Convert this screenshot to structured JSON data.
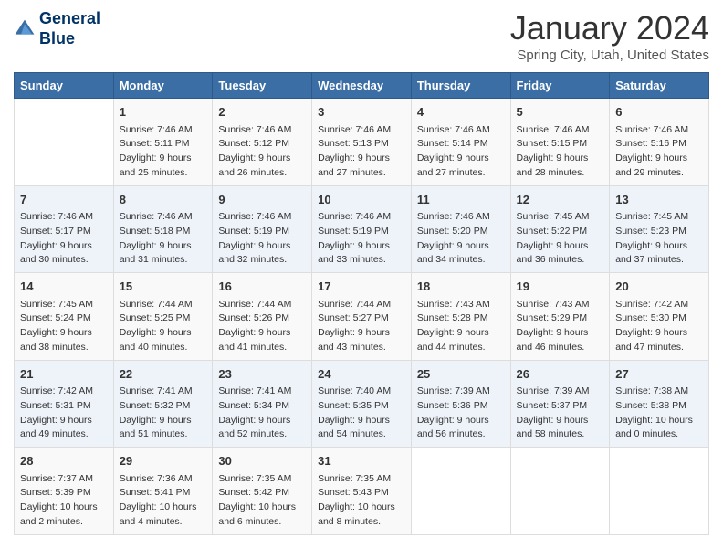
{
  "header": {
    "logo_line1": "General",
    "logo_line2": "Blue",
    "title": "January 2024",
    "subtitle": "Spring City, Utah, United States"
  },
  "days_of_week": [
    "Sunday",
    "Monday",
    "Tuesday",
    "Wednesday",
    "Thursday",
    "Friday",
    "Saturday"
  ],
  "weeks": [
    [
      {
        "num": "",
        "info": ""
      },
      {
        "num": "1",
        "info": "Sunrise: 7:46 AM\nSunset: 5:11 PM\nDaylight: 9 hours\nand 25 minutes."
      },
      {
        "num": "2",
        "info": "Sunrise: 7:46 AM\nSunset: 5:12 PM\nDaylight: 9 hours\nand 26 minutes."
      },
      {
        "num": "3",
        "info": "Sunrise: 7:46 AM\nSunset: 5:13 PM\nDaylight: 9 hours\nand 27 minutes."
      },
      {
        "num": "4",
        "info": "Sunrise: 7:46 AM\nSunset: 5:14 PM\nDaylight: 9 hours\nand 27 minutes."
      },
      {
        "num": "5",
        "info": "Sunrise: 7:46 AM\nSunset: 5:15 PM\nDaylight: 9 hours\nand 28 minutes."
      },
      {
        "num": "6",
        "info": "Sunrise: 7:46 AM\nSunset: 5:16 PM\nDaylight: 9 hours\nand 29 minutes."
      }
    ],
    [
      {
        "num": "7",
        "info": "Sunrise: 7:46 AM\nSunset: 5:17 PM\nDaylight: 9 hours\nand 30 minutes."
      },
      {
        "num": "8",
        "info": "Sunrise: 7:46 AM\nSunset: 5:18 PM\nDaylight: 9 hours\nand 31 minutes."
      },
      {
        "num": "9",
        "info": "Sunrise: 7:46 AM\nSunset: 5:19 PM\nDaylight: 9 hours\nand 32 minutes."
      },
      {
        "num": "10",
        "info": "Sunrise: 7:46 AM\nSunset: 5:19 PM\nDaylight: 9 hours\nand 33 minutes."
      },
      {
        "num": "11",
        "info": "Sunrise: 7:46 AM\nSunset: 5:20 PM\nDaylight: 9 hours\nand 34 minutes."
      },
      {
        "num": "12",
        "info": "Sunrise: 7:45 AM\nSunset: 5:22 PM\nDaylight: 9 hours\nand 36 minutes."
      },
      {
        "num": "13",
        "info": "Sunrise: 7:45 AM\nSunset: 5:23 PM\nDaylight: 9 hours\nand 37 minutes."
      }
    ],
    [
      {
        "num": "14",
        "info": "Sunrise: 7:45 AM\nSunset: 5:24 PM\nDaylight: 9 hours\nand 38 minutes."
      },
      {
        "num": "15",
        "info": "Sunrise: 7:44 AM\nSunset: 5:25 PM\nDaylight: 9 hours\nand 40 minutes."
      },
      {
        "num": "16",
        "info": "Sunrise: 7:44 AM\nSunset: 5:26 PM\nDaylight: 9 hours\nand 41 minutes."
      },
      {
        "num": "17",
        "info": "Sunrise: 7:44 AM\nSunset: 5:27 PM\nDaylight: 9 hours\nand 43 minutes."
      },
      {
        "num": "18",
        "info": "Sunrise: 7:43 AM\nSunset: 5:28 PM\nDaylight: 9 hours\nand 44 minutes."
      },
      {
        "num": "19",
        "info": "Sunrise: 7:43 AM\nSunset: 5:29 PM\nDaylight: 9 hours\nand 46 minutes."
      },
      {
        "num": "20",
        "info": "Sunrise: 7:42 AM\nSunset: 5:30 PM\nDaylight: 9 hours\nand 47 minutes."
      }
    ],
    [
      {
        "num": "21",
        "info": "Sunrise: 7:42 AM\nSunset: 5:31 PM\nDaylight: 9 hours\nand 49 minutes."
      },
      {
        "num": "22",
        "info": "Sunrise: 7:41 AM\nSunset: 5:32 PM\nDaylight: 9 hours\nand 51 minutes."
      },
      {
        "num": "23",
        "info": "Sunrise: 7:41 AM\nSunset: 5:34 PM\nDaylight: 9 hours\nand 52 minutes."
      },
      {
        "num": "24",
        "info": "Sunrise: 7:40 AM\nSunset: 5:35 PM\nDaylight: 9 hours\nand 54 minutes."
      },
      {
        "num": "25",
        "info": "Sunrise: 7:39 AM\nSunset: 5:36 PM\nDaylight: 9 hours\nand 56 minutes."
      },
      {
        "num": "26",
        "info": "Sunrise: 7:39 AM\nSunset: 5:37 PM\nDaylight: 9 hours\nand 58 minutes."
      },
      {
        "num": "27",
        "info": "Sunrise: 7:38 AM\nSunset: 5:38 PM\nDaylight: 10 hours\nand 0 minutes."
      }
    ],
    [
      {
        "num": "28",
        "info": "Sunrise: 7:37 AM\nSunset: 5:39 PM\nDaylight: 10 hours\nand 2 minutes."
      },
      {
        "num": "29",
        "info": "Sunrise: 7:36 AM\nSunset: 5:41 PM\nDaylight: 10 hours\nand 4 minutes."
      },
      {
        "num": "30",
        "info": "Sunrise: 7:35 AM\nSunset: 5:42 PM\nDaylight: 10 hours\nand 6 minutes."
      },
      {
        "num": "31",
        "info": "Sunrise: 7:35 AM\nSunset: 5:43 PM\nDaylight: 10 hours\nand 8 minutes."
      },
      {
        "num": "",
        "info": ""
      },
      {
        "num": "",
        "info": ""
      },
      {
        "num": "",
        "info": ""
      }
    ]
  ]
}
